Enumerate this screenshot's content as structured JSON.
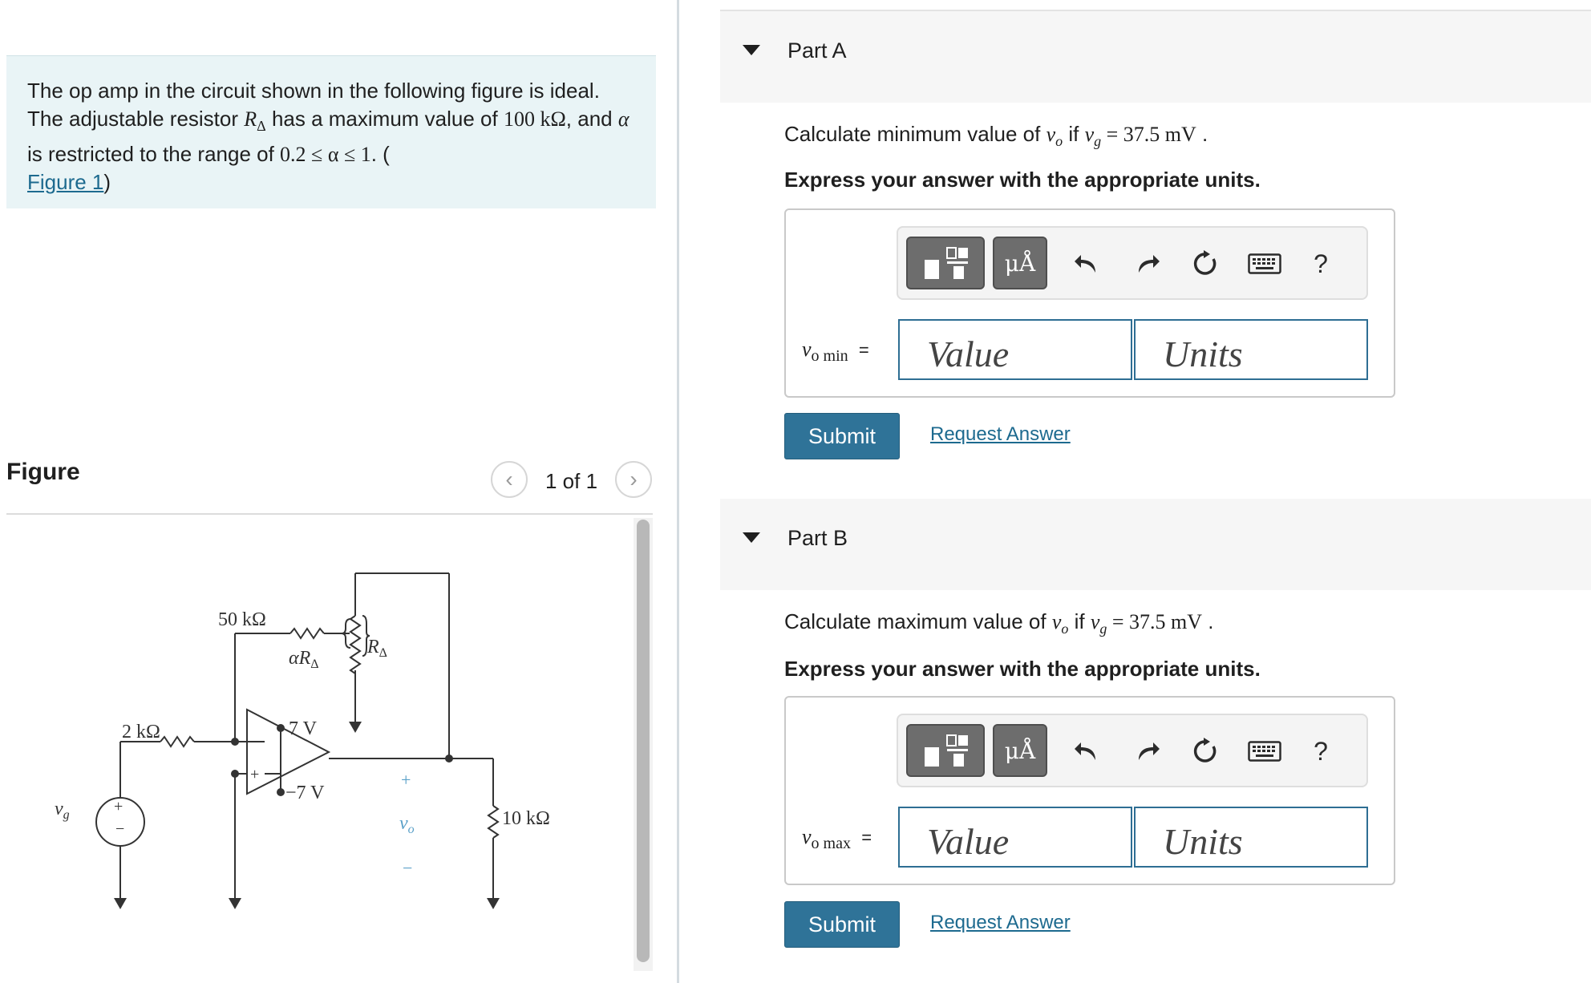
{
  "problem": {
    "text_1": "The op amp in the circuit shown in the following figure is ideal. The adjustable resistor ",
    "r_symbol": "R",
    "r_sub": "Δ",
    "text_2": " has a maximum value of ",
    "max_value": "100 kΩ",
    "text_3": ", and ",
    "alpha": "α",
    "text_4": " is restricted to the range of ",
    "range": "0.2 ≤ α ≤ 1",
    "text_5": ". (",
    "figure_link": "Figure 1",
    "text_6": ")"
  },
  "figure": {
    "heading": "Figure",
    "pager": "1 of 1",
    "prev_glyph": "‹",
    "next_glyph": "›",
    "circuit": {
      "r1": "2 kΩ",
      "r2": "50 kΩ",
      "alpha_r": "αR",
      "alpha_r_sub": "Δ",
      "r_delta": "R",
      "r_delta_sub": "Δ",
      "vpos": "7 V",
      "vneg": "−7 V",
      "vg": "v",
      "vg_sub": "g",
      "vo": "v",
      "vo_sub": "o",
      "rl": "10 kΩ",
      "plus": "+",
      "minus": "−"
    }
  },
  "parts": [
    {
      "title": "Part A",
      "question_pre": "Calculate minimum value of ",
      "question_vo": "v",
      "question_vo_sub": "o",
      "question_mid": " if ",
      "question_vg": "v",
      "question_vg_sub": "g",
      "question_eq": " = 37.5 mV",
      "question_end": " .",
      "express": "Express your answer with the appropriate units.",
      "units_btn": "μÅ",
      "help": "?",
      "var": "v",
      "var_sub": "o min",
      "equals": "=",
      "value_placeholder": "Value",
      "units_placeholder": "Units",
      "submit": "Submit",
      "request": "Request Answer"
    },
    {
      "title": "Part B",
      "question_pre": "Calculate maximum value of ",
      "question_vo": "v",
      "question_vo_sub": "o",
      "question_mid": " if ",
      "question_vg": "v",
      "question_vg_sub": "g",
      "question_eq": " = 37.5 mV",
      "question_end": " .",
      "express": "Express your answer with the appropriate units.",
      "units_btn": "μÅ",
      "help": "?",
      "var": "v",
      "var_sub": "o max",
      "equals": "=",
      "value_placeholder": "Value",
      "units_placeholder": "Units",
      "submit": "Submit",
      "request": "Request Answer"
    }
  ]
}
